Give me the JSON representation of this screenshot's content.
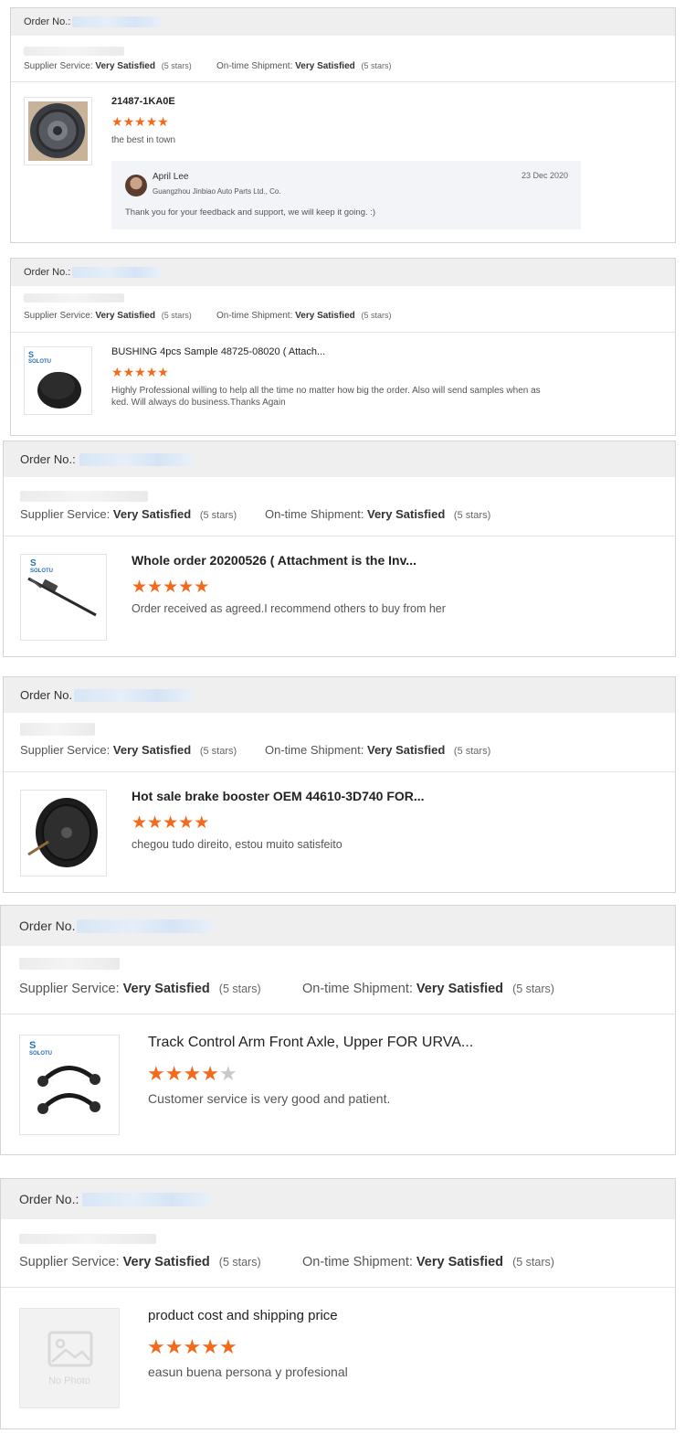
{
  "orders": [
    {
      "order_label": "Order No.:",
      "supplier_service_label": "Supplier Service:",
      "supplier_service_value": "Very Satisfied",
      "supplier_service_stars": "(5 stars)",
      "shipment_label": "On-time Shipment:",
      "shipment_value": "Very Satisfied",
      "shipment_stars": "(5 stars)",
      "product_title": "21487-1KA0E",
      "rating": 5,
      "comment": "the best in town",
      "reply": {
        "name": "April Lee",
        "company": "Guangzhou Jinbiao Auto Parts Ltd., Co.",
        "date": "23 Dec 2020",
        "text": "Thank you for your feedback and support, we will keep it going. :)"
      }
    },
    {
      "order_label": "Order No.:",
      "supplier_service_label": "Supplier Service:",
      "supplier_service_value": "Very Satisfied",
      "supplier_service_stars": "(5 stars)",
      "shipment_label": "On-time Shipment:",
      "shipment_value": "Very Satisfied",
      "shipment_stars": "(5 stars)",
      "product_title": "BUSHING 4pcs Sample 48725-08020 ( Attach...",
      "rating": 5,
      "comment": "Highly Professional willing to help all the time no matter how big the order. Also will send samples when as ked. Will always do business.Thanks Again"
    },
    {
      "order_label": "Order No.:",
      "supplier_service_label": "Supplier Service:",
      "supplier_service_value": "Very Satisfied",
      "supplier_service_stars": "(5 stars)",
      "shipment_label": "On-time Shipment:",
      "shipment_value": "Very Satisfied",
      "shipment_stars": "(5 stars)",
      "product_title": "Whole order 20200526 ( Attachment is the Inv...",
      "rating": 5,
      "comment": "Order received as agreed.I recommend others to buy from her"
    },
    {
      "order_label": "Order No.",
      "supplier_service_label": "Supplier Service:",
      "supplier_service_value": "Very Satisfied",
      "supplier_service_stars": "(5 stars)",
      "shipment_label": "On-time Shipment:",
      "shipment_value": "Very Satisfied",
      "shipment_stars": "(5 stars)",
      "product_title": "Hot sale brake booster OEM 44610-3D740 FOR...",
      "rating": 5,
      "comment": "chegou tudo direito, estou muito satisfeito"
    },
    {
      "order_label": "Order No.",
      "supplier_service_label": "Supplier Service:",
      "supplier_service_value": "Very Satisfied",
      "supplier_service_stars": "(5 stars)",
      "shipment_label": "On-time Shipment:",
      "shipment_value": "Very Satisfied",
      "shipment_stars": "(5 stars)",
      "product_title": "Track Control Arm Front Axle, Upper FOR URVA...",
      "rating": 4,
      "comment": "Customer service is very good and patient."
    },
    {
      "order_label": "Order No.:",
      "supplier_service_label": "Supplier Service:",
      "supplier_service_value": "Very Satisfied",
      "supplier_service_stars": "(5 stars)",
      "shipment_label": "On-time Shipment:",
      "shipment_value": "Very Satisfied",
      "shipment_stars": "(5 stars)",
      "product_title": "product cost and shipping price",
      "rating": 5,
      "comment": "easun buena persona y profesional",
      "no_photo_label": "No Photo"
    }
  ],
  "brand": {
    "logo_text": "SOLOTU",
    "accent_color": "#f26b1d",
    "inactive_star_color": "#c9c9c9"
  }
}
